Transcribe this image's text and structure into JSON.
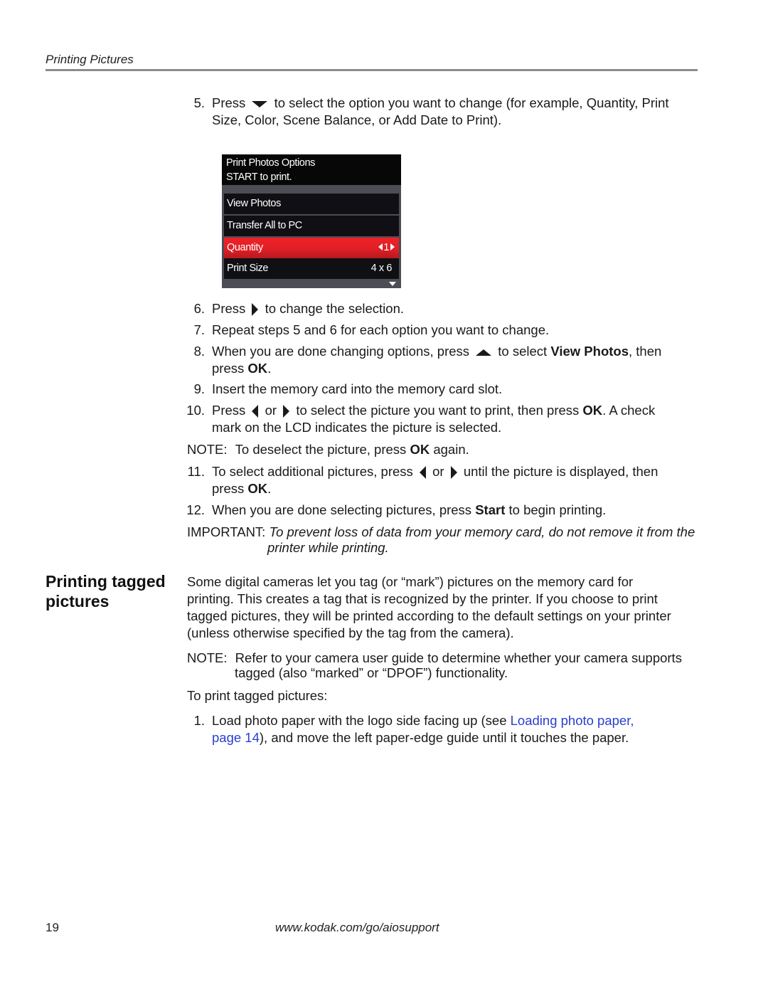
{
  "header": {
    "title": "Printing Pictures"
  },
  "steps_top": {
    "step5": {
      "num": "5.",
      "a": "Press",
      "b": "to select the option you want to change (for example, Quantity, Print",
      "c": "Size, Color, Scene Balance, or Add Date to Print).",
      "icon": "down-arrow-icon"
    }
  },
  "lcd": {
    "title": "Print Photos Options",
    "subtitle": "START to print.",
    "rows": [
      {
        "label": "View Photos",
        "value": ""
      },
      {
        "label": "Transfer All to PC",
        "value": ""
      },
      {
        "label": "Quantity",
        "value": "1",
        "selected": true
      },
      {
        "label": "Print Size",
        "value": "4 x 6"
      }
    ],
    "colors": {
      "selected": "#e01f26",
      "background": "#0f0f14"
    }
  },
  "steps": {
    "s6": {
      "num": "6.",
      "a": "Press",
      "b": "to change the selection."
    },
    "s7": {
      "num": "7.",
      "a": "Repeat steps 5 and 6 for each option you want to change."
    },
    "s8": {
      "num": "8.",
      "a": "When you are done changing options, press",
      "b": "to select",
      "bold1": "View Photos",
      "c": ", then",
      "d": "press",
      "bold2": "OK",
      "e": "."
    },
    "s9": {
      "num": "9.",
      "a": "Insert the memory card into the memory card slot."
    },
    "s10": {
      "num": "10.",
      "a": "Press",
      "or": "or",
      "b": "to select the picture you want to print, then press",
      "bold": "OK",
      "c": ". A check",
      "d": "mark on the LCD indicates the picture is selected."
    },
    "note1": {
      "label": "NOTE:",
      "a": "To deselect the picture, press",
      "bold": "OK",
      "b": "again."
    },
    "s11": {
      "num": "11.",
      "a": "To select additional pictures, press",
      "or": "or",
      "b": "until the picture is displayed, then",
      "c": "press",
      "bold": "OK",
      "d": "."
    },
    "s12": {
      "num": "12.",
      "a": "When you are done selecting pictures, press",
      "bold": "Start",
      "b": "to begin printing."
    },
    "important": {
      "label": "IMPORTANT:",
      "a": "To prevent loss of data from your memory card, do not remove it from the",
      "b": "printer while printing."
    }
  },
  "section": {
    "heading_line1": "Printing tagged",
    "heading_line2": "pictures",
    "para": [
      "Some digital cameras let you tag (or “mark”) pictures on the memory card for",
      "printing. This creates a tag that is recognized by the printer. If you choose to print",
      "tagged pictures, they will be printed according to the default settings on your printer",
      "(unless otherwise specified by the tag from the camera)."
    ],
    "note": {
      "label": "NOTE:",
      "a": "Refer to your camera user guide to determine whether your camera supports",
      "b": "tagged (also “marked” or “DPOF”) functionality."
    },
    "intro": "To print tagged pictures:",
    "step1": {
      "num": "1.",
      "a": "Load photo paper with the logo side facing up (see",
      "link1": "Loading photo paper,",
      "link2": "page 14",
      "b": "), and move the left paper-edge guide until it touches the paper."
    }
  },
  "footer": {
    "page": "19",
    "url": "www.kodak.com/go/aiosupport"
  },
  "colors": {
    "link": "#2a3ecf",
    "rule": "#8c8c8c"
  }
}
